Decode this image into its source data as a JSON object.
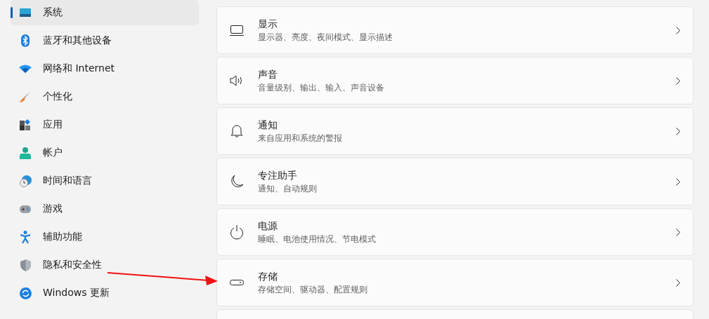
{
  "sidebar": {
    "items": [
      {
        "label": "系统",
        "selected": true
      },
      {
        "label": "蓝牙和其他设备",
        "selected": false
      },
      {
        "label": "网络和 Internet",
        "selected": false
      },
      {
        "label": "个性化",
        "selected": false
      },
      {
        "label": "应用",
        "selected": false
      },
      {
        "label": "帐户",
        "selected": false
      },
      {
        "label": "时间和语言",
        "selected": false
      },
      {
        "label": "游戏",
        "selected": false
      },
      {
        "label": "辅助功能",
        "selected": false
      },
      {
        "label": "隐私和安全性",
        "selected": false
      },
      {
        "label": "Windows 更新",
        "selected": false
      }
    ]
  },
  "settings": [
    {
      "kind": "setting",
      "title": "显示",
      "subtitle": "显示器、亮度、夜间模式、显示描述"
    },
    {
      "kind": "setting",
      "title": "声音",
      "subtitle": "音量级别、输出、输入、声音设备"
    },
    {
      "kind": "setting",
      "title": "通知",
      "subtitle": "来自应用和系统的警报"
    },
    {
      "kind": "setting",
      "title": "专注助手",
      "subtitle": "通知、自动规则"
    },
    {
      "kind": "setting",
      "title": "电源",
      "subtitle": "睡眠、电池使用情况、节电模式"
    },
    {
      "kind": "setting",
      "title": "存储",
      "subtitle": "存储空间、驱动器、配置规则"
    },
    {
      "kind": "partial"
    }
  ]
}
